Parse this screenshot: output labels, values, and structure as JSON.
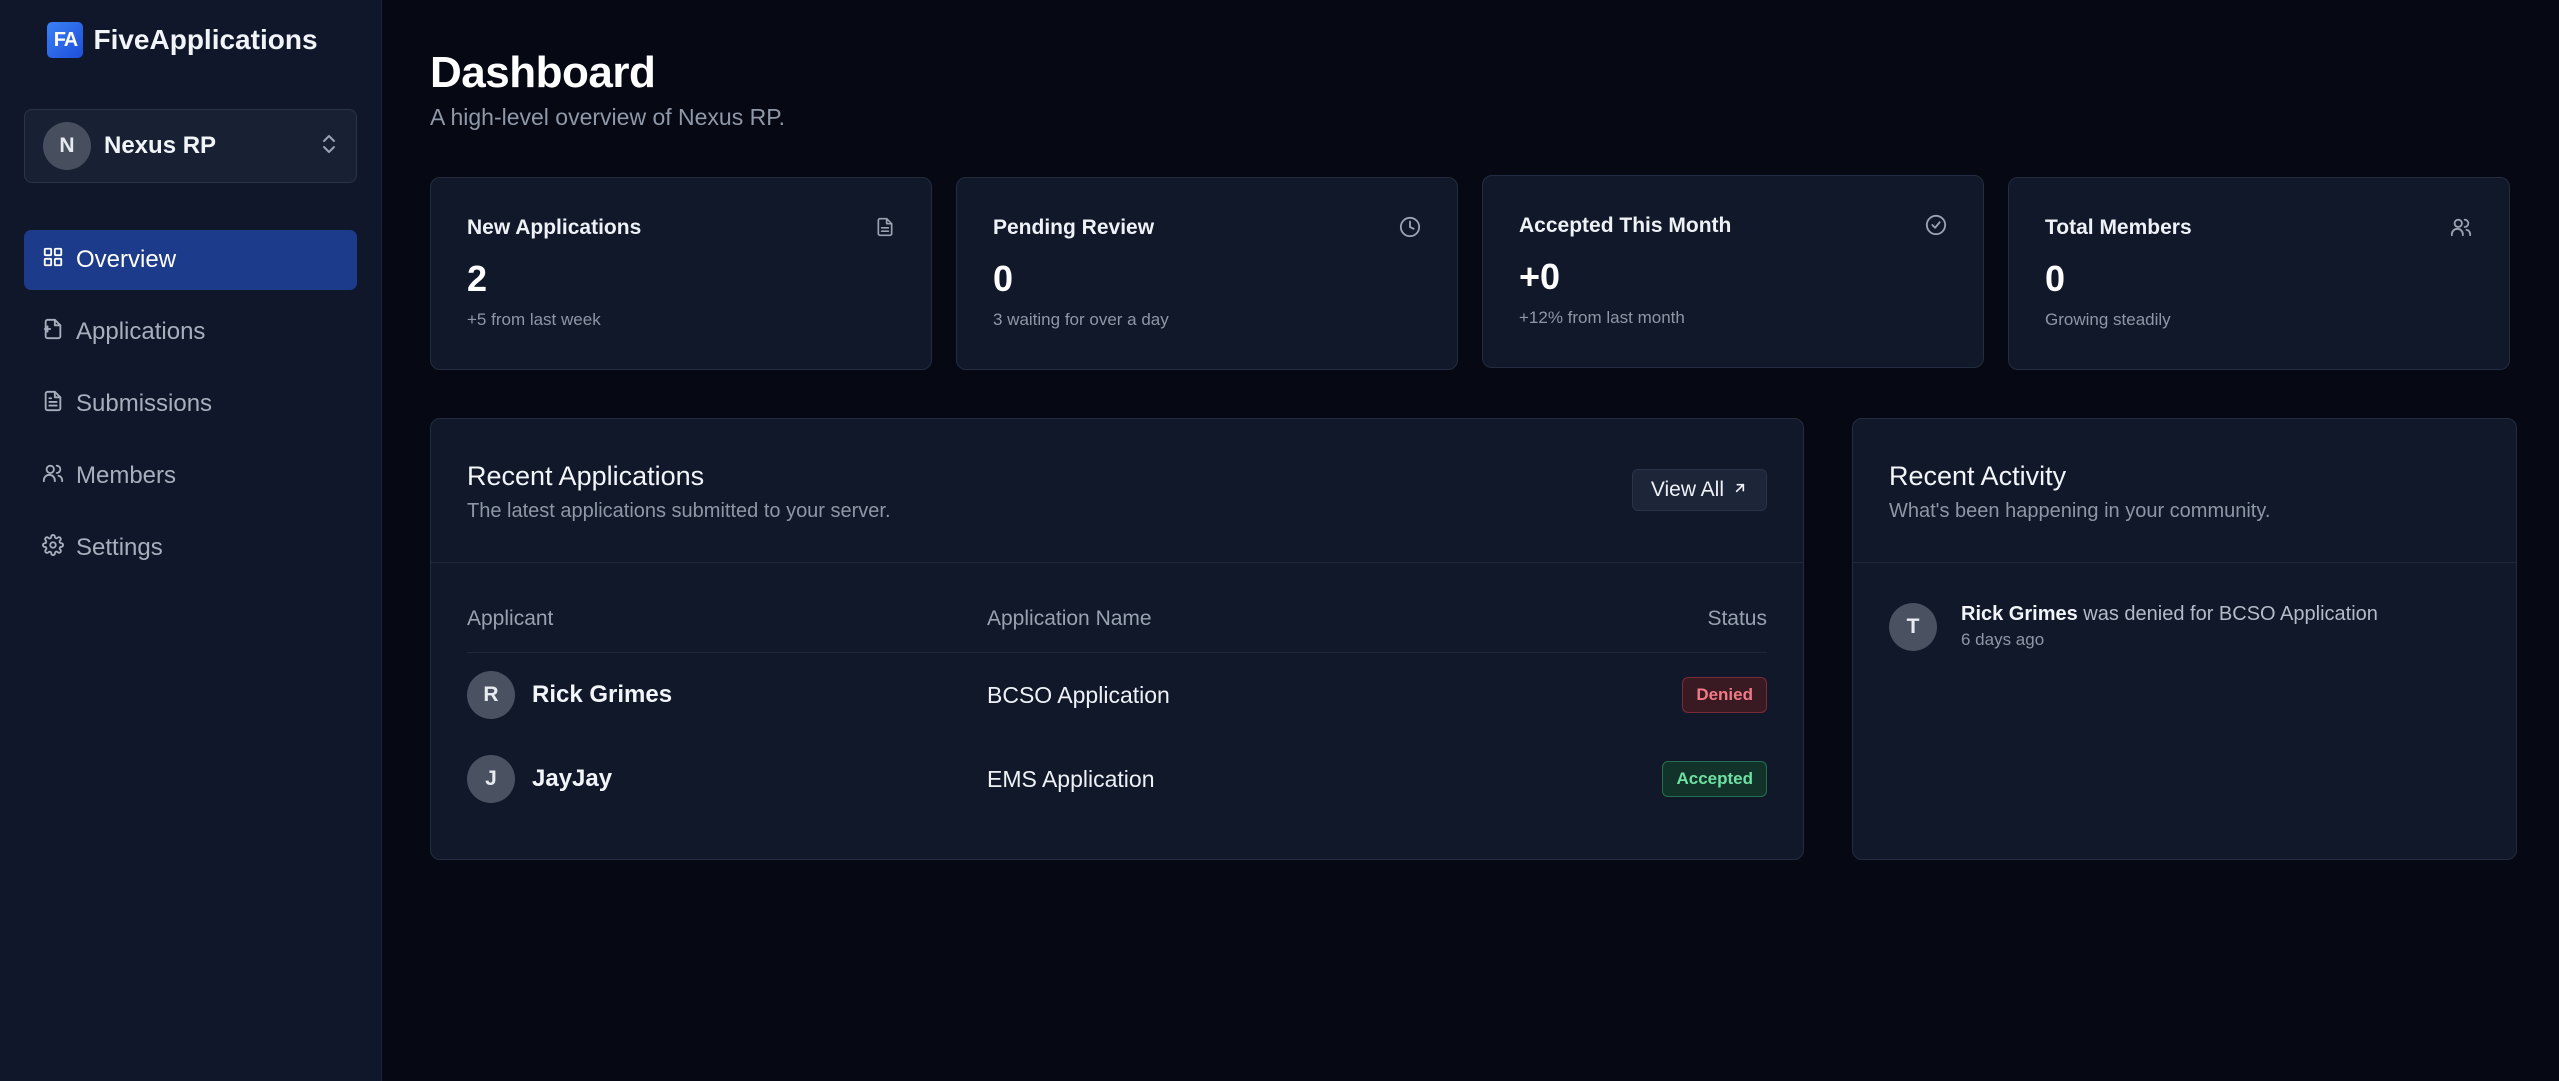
{
  "brand": {
    "logo": "FA",
    "name": "FiveApplications"
  },
  "server": {
    "initial": "N",
    "name": "Nexus RP"
  },
  "nav": [
    {
      "label": "Overview",
      "icon": "grid-icon",
      "active": true
    },
    {
      "label": "Applications",
      "icon": "file-plus-icon"
    },
    {
      "label": "Submissions",
      "icon": "file-text-icon"
    },
    {
      "label": "Members",
      "icon": "users-icon"
    },
    {
      "label": "Settings",
      "icon": "gear-icon"
    }
  ],
  "page": {
    "title": "Dashboard",
    "subtitle": "A high-level overview of Nexus RP."
  },
  "stats": [
    {
      "label": "New Applications",
      "value": "2",
      "note": "+5 from last week",
      "icon": "document-icon"
    },
    {
      "label": "Pending Review",
      "value": "0",
      "note": "3 waiting for over a day",
      "icon": "clock-icon"
    },
    {
      "label": "Accepted This Month",
      "value": "+0",
      "note": "+12% from last month",
      "icon": "check-circle-icon"
    },
    {
      "label": "Total Members",
      "value": "0",
      "note": "Growing steadily",
      "icon": "users-icon"
    }
  ],
  "recent_apps": {
    "title": "Recent Applications",
    "subtitle": "The latest applications submitted to your server.",
    "view_all": "View All",
    "columns": [
      "Applicant",
      "Application Name",
      "Status"
    ],
    "rows": [
      {
        "initial": "R",
        "name": "Rick Grimes",
        "application": "BCSO Application",
        "status": "Denied"
      },
      {
        "initial": "J",
        "name": "JayJay",
        "application": "EMS Application",
        "status": "Accepted"
      }
    ]
  },
  "recent_activity": {
    "title": "Recent Activity",
    "subtitle": "What's been happening in your community.",
    "items": [
      {
        "initial": "T",
        "actor": "Rick Grimes",
        "text": " was denied for BCSO Application",
        "time": "6 days ago"
      }
    ]
  },
  "colors": {
    "background": "#060913",
    "sidebar": "#10172a",
    "card": "#111829",
    "accent": "#1d3b8b",
    "denied": "#f07a85",
    "accepted": "#6ee0a1"
  }
}
